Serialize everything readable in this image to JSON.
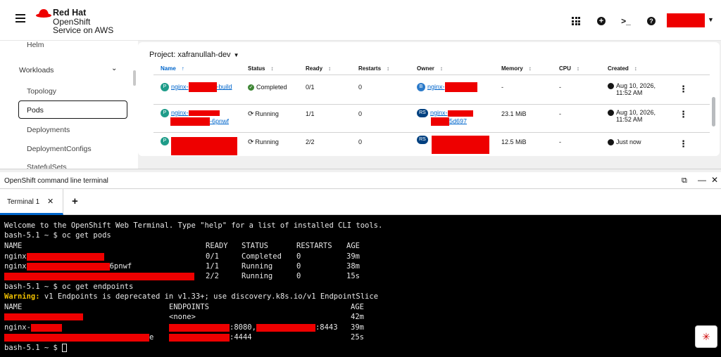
{
  "brand": {
    "line1": "Red Hat",
    "line2": "OpenShift",
    "line3": "Service on AWS"
  },
  "masthead": {
    "terminal_glyph": ">_",
    "help_glyph": "?",
    "add_glyph": "+"
  },
  "sidebar": {
    "items": [
      {
        "label": "Helm"
      },
      {
        "label": "Workloads"
      },
      {
        "label": "Topology"
      },
      {
        "label": "Pods"
      },
      {
        "label": "Deployments"
      },
      {
        "label": "DeploymentConfigs"
      },
      {
        "label": "StatefulSets"
      }
    ]
  },
  "project": {
    "label": "Project: xafranullah-dev"
  },
  "table": {
    "columns": [
      "Name",
      "Status",
      "Ready",
      "Restarts",
      "Owner",
      "Memory",
      "CPU",
      "Created"
    ],
    "rows": [
      {
        "badge": "P",
        "name_start": "nginx-",
        "name_end": "-build",
        "status": "Completed",
        "ready": "0/1",
        "restarts": "0",
        "owner_badge": "B",
        "owner": "nginx-",
        "memory": "-",
        "cpu": "-",
        "created_1": "Aug 10, 2026,",
        "created_2": "11:52 AM"
      },
      {
        "badge": "P",
        "name_start": "nginx-",
        "name_end": "-6pnwf",
        "status": "Running",
        "ready": "1/1",
        "restarts": "0",
        "owner_badge": "RS",
        "owner": "nginx-",
        "owner_end": "5d697",
        "memory": "23.1 MiB",
        "cpu": "-",
        "created_1": "Aug 10, 2026,",
        "created_2": "11:52 AM"
      },
      {
        "badge": "P",
        "status": "Running",
        "ready": "2/2",
        "restarts": "0",
        "owner_badge": "RS",
        "memory": "12.5 MiB",
        "cpu": "-",
        "created_1": "Just now"
      }
    ]
  },
  "drawer": {
    "title": "OpenShift command line terminal",
    "tab_label": "Terminal 1",
    "popout_glyph": "⧉",
    "minimize_glyph": "—",
    "close_glyph": "✕"
  },
  "terminal": {
    "welcome": "Welcome to the OpenShift Web Terminal. Type \"help\" for a list of installed CLI tools.",
    "prompt1": "bash-5.1 ~ $ oc get pods",
    "pods_header": {
      "name": "NAME",
      "ready": "READY",
      "status": "STATUS",
      "restarts": "RESTARTS",
      "age": "AGE"
    },
    "pods": [
      {
        "name": "nginx",
        "ready": "0/1",
        "status": "Completed",
        "restarts": "0",
        "age": "39m"
      },
      {
        "name": "nginx",
        "name_end": "6pnwf",
        "ready": "1/1",
        "status": "Running",
        "restarts": "0",
        "age": "38m"
      },
      {
        "ready": "2/2",
        "status": "Running",
        "restarts": "0",
        "age": "15s"
      }
    ],
    "prompt2": "bash-5.1 ~ $ oc get endpoints",
    "warning_label": "Warning:",
    "warning_text": " v1 Endpoints is deprecated in v1.33+; use discovery.k8s.io/v1 EndpointSlice",
    "ep_header": {
      "name": "NAME",
      "endpoints": "ENDPOINTS",
      "age": "AGE"
    },
    "endpoints": [
      {
        "endpoints": "<none>",
        "age": "42m"
      },
      {
        "name": "nginx-",
        "port1": ":8080,",
        "port2": ":8443",
        "age": "39m"
      },
      {
        "name_end": "e",
        "port1": ":4444",
        "age": "25s"
      }
    ],
    "prompt3": "bash-5.1 ~ $ "
  },
  "colors": {
    "redaction": "#ee0000",
    "link": "#0066cc",
    "terminal_bg": "#000000",
    "warning": "#f0c000"
  }
}
